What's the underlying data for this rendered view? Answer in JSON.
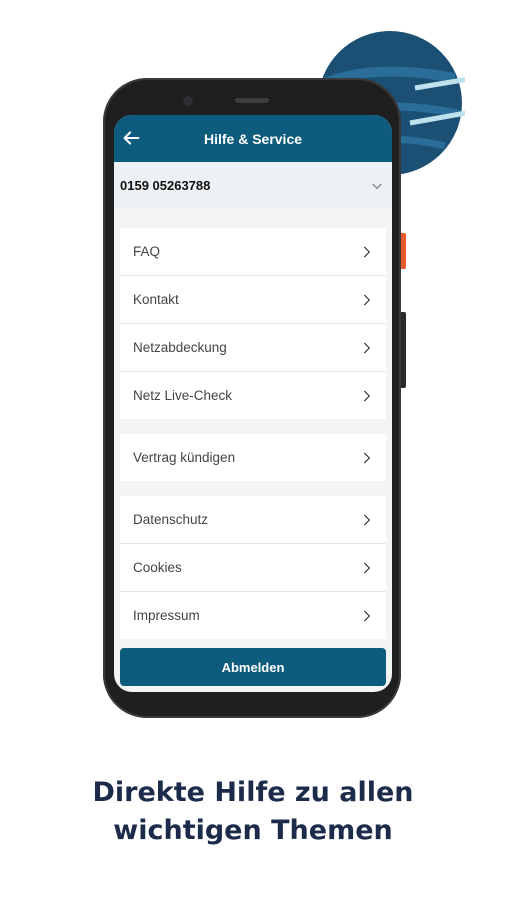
{
  "colors": {
    "primary": "#0d5c7e",
    "caption": "#1d2b4a",
    "background": "#ffffff",
    "planet": "#1b4f74"
  },
  "header": {
    "title": "Hilfe & Service",
    "back_icon": "arrow-left-icon"
  },
  "selector": {
    "value": "0159 05263788",
    "icon": "chevron-down-icon"
  },
  "groups": [
    {
      "items": [
        {
          "label": "FAQ"
        },
        {
          "label": "Kontakt"
        },
        {
          "label": "Netzabdeckung"
        },
        {
          "label": "Netz Live-Check"
        }
      ]
    },
    {
      "items": [
        {
          "label": "Vertrag kündigen"
        }
      ]
    },
    {
      "items": [
        {
          "label": "Datenschutz"
        },
        {
          "label": "Cookies"
        },
        {
          "label": "Impressum"
        }
      ]
    }
  ],
  "logout_label": "Abmelden",
  "caption": {
    "line1": "Direkte Hilfe zu allen",
    "line2": "wichtigen Themen"
  }
}
